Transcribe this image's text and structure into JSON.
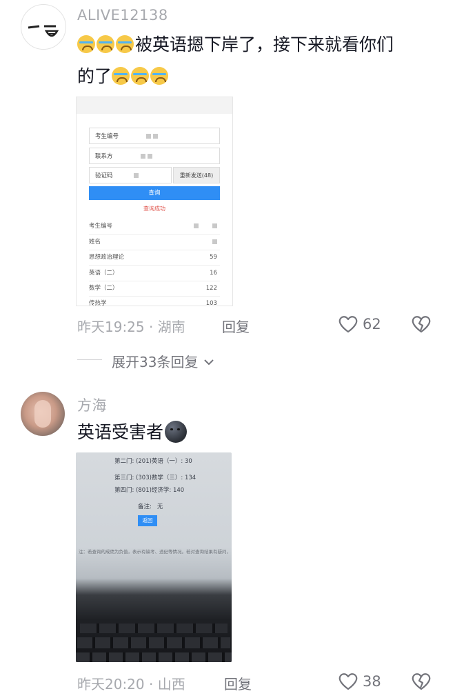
{
  "comments": [
    {
      "username": "ALIVE12138",
      "text_main": "被英语摁下岸了，接下来就看你们",
      "text_tail": "的了",
      "time": "昨天19:25",
      "location": "湖南",
      "reply_label": "回复",
      "likes": "62",
      "expand_label": "展开33条回复",
      "avatar_glyph": "一 ≡",
      "screenshot": {
        "fields": [
          {
            "label": "考生编号"
          },
          {
            "label": "联系方"
          },
          {
            "label": "验证码",
            "button": "重新发送(48)"
          }
        ],
        "query_button": "查询",
        "success_text": "查询成功",
        "rows": [
          {
            "label": "考生编号",
            "value": ""
          },
          {
            "label": "姓名",
            "value": ""
          },
          {
            "label": "思想政治理论",
            "value": "59"
          },
          {
            "label": "英语（二）",
            "value": "16"
          },
          {
            "label": "数学（二）",
            "value": "122"
          },
          {
            "label": "传热学",
            "value": "103"
          }
        ]
      }
    },
    {
      "username": "方海",
      "text": "英语受害者",
      "time": "昨天20:20",
      "location": "山西",
      "reply_label": "回复",
      "likes": "38",
      "photo": {
        "lines": [
          "第二门:    (201)英语（一）: 30",
          "第三门:    (303)数学（三）: 134",
          "第四门:    (801)经济学: 140"
        ],
        "note_label": "备注:",
        "note_value": "无",
        "back_button": "返回",
        "footer_note": "注：若查询的成绩为负值，表示有缺考、违纪等情况。若对查询结果有疑问，"
      }
    }
  ],
  "colors": {
    "accent": "#2f8ef5",
    "muted": "#a7a9ae",
    "text": "#161823"
  }
}
